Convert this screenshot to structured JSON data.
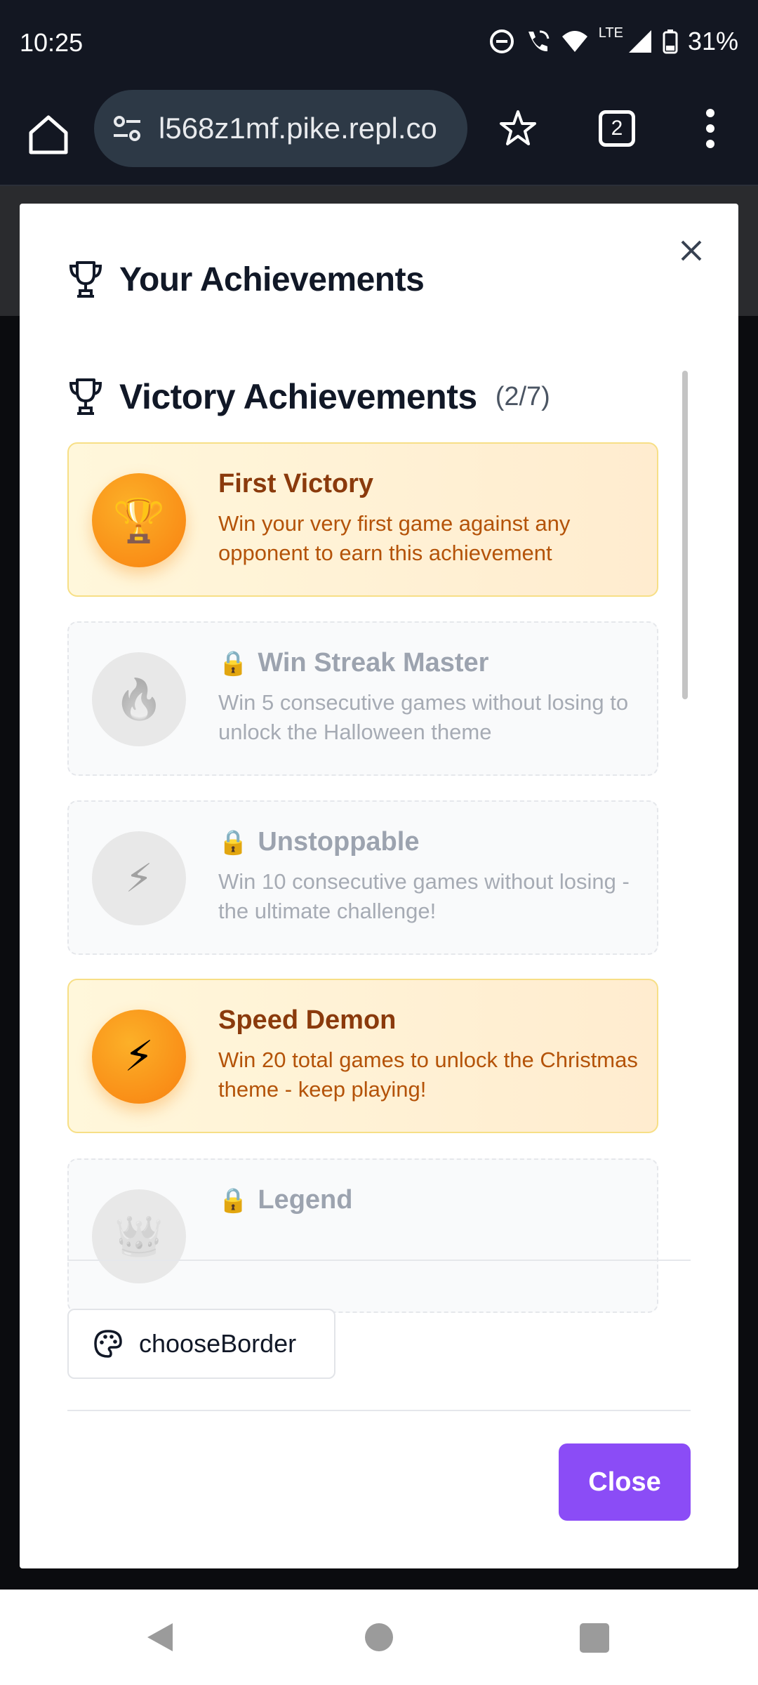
{
  "status_bar": {
    "time": "10:25",
    "network": "LTE",
    "battery": "31%"
  },
  "browser": {
    "url": "l568z1mf.pike.repl.co",
    "tab_count": "2",
    "icons": [
      "home-icon",
      "site-settings-icon",
      "star-icon",
      "tabs-icon",
      "more-vert-icon"
    ]
  },
  "modal": {
    "title": "Your Achievements",
    "section": {
      "title": "Victory Achievements",
      "count": "(2/7)"
    },
    "achievements": [
      {
        "title": "First Victory",
        "description": "Win your very first game against any opponent to earn this achievement",
        "icon": "🏆",
        "unlocked": true
      },
      {
        "title": "Win Streak Master",
        "description": "Win 5 consecutive games without losing to unlock the Halloween theme",
        "icon": "🔥",
        "unlocked": false
      },
      {
        "title": "Unstoppable",
        "description": "Win 10 consecutive games without losing - the ultimate challenge!",
        "icon": "⚡",
        "unlocked": false
      },
      {
        "title": "Speed Demon",
        "description": "Win 20 total games to unlock the Christmas theme - keep playing!",
        "icon": "⚡",
        "unlocked": true
      },
      {
        "title": "Legend",
        "description": "",
        "icon": "👑",
        "unlocked": false
      }
    ],
    "lock_glyph": "🔒",
    "border_button_label": "chooseBorder",
    "close_button_label": "Close"
  },
  "colors": {
    "accent": "#8b4cf6",
    "unlocked_title": "#8a3a0c",
    "unlocked_desc": "#b45309",
    "badge_orange": "#f98a15"
  }
}
